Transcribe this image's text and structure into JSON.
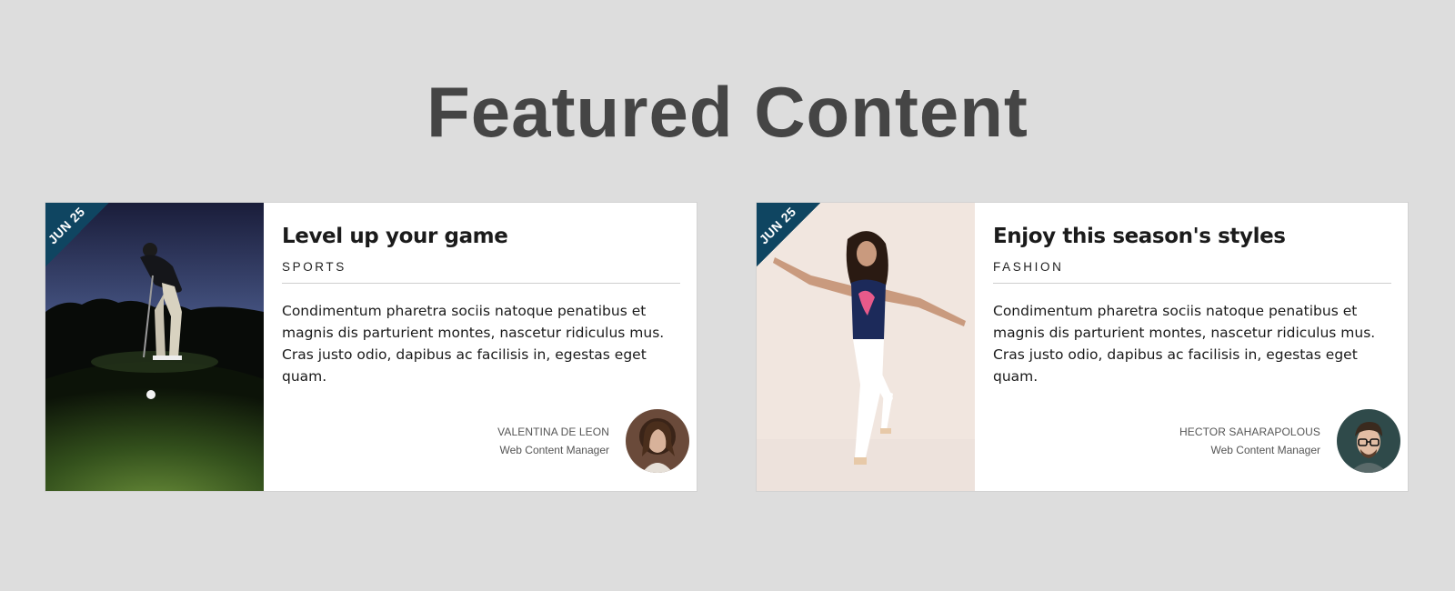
{
  "page": {
    "title": "Featured Content"
  },
  "cards": [
    {
      "date": "JUN 25",
      "title": "Level up your game",
      "category": "SPORTS",
      "text": "Condimentum pharetra sociis natoque penatibus et magnis dis parturient montes, nascetur ridiculus mus. Cras justo odio, dapibus ac facilisis in, egestas eget quam.",
      "author_name": "VALENTINA DE LEON",
      "author_role": "Web Content Manager",
      "image": "golfer-putting-photo",
      "avatar": "woman-avatar"
    },
    {
      "date": "JUN 25",
      "title": "Enjoy this season's styles",
      "category": "FASHION",
      "text": "Condimentum pharetra sociis natoque penatibus et magnis dis parturient montes, nascetur ridiculus mus. Cras justo odio, dapibus ac facilisis in, egestas eget quam.",
      "author_name": "HECTOR SAHARAPOLOUS",
      "author_role": "Web Content Manager",
      "image": "fashion-model-photo",
      "avatar": "man-glasses-avatar"
    }
  ],
  "colors": {
    "background": "#dddddd",
    "title": "#454545",
    "ribbon": "#0f4561",
    "card": "#ffffff"
  }
}
